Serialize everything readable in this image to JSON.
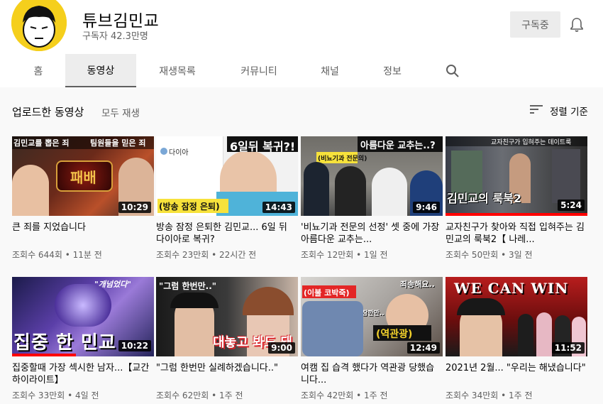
{
  "channel": {
    "name": "튜브김민교",
    "subscribers": "구독자 42.3만명",
    "subscribe_label": "구독중"
  },
  "tabs": [
    {
      "label": "홈"
    },
    {
      "label": "동영상"
    },
    {
      "label": "재생목록"
    },
    {
      "label": "커뮤니티"
    },
    {
      "label": "채널"
    },
    {
      "label": "정보"
    }
  ],
  "section": {
    "title": "업로드한 동영상",
    "play_all": "모두 재생",
    "sort_label": "정렬 기준"
  },
  "videos": [
    {
      "title": "큰 죄를 지었습니다",
      "views": "조회수 644회",
      "time": "11분 전",
      "duration": "10:29",
      "thumb_text": [
        "김민교를 뽑은 죄",
        "팀원들을 믿은 죄",
        "패배"
      ],
      "watched": 0
    },
    {
      "title": "방송 잠정 은퇴한 김민교... 6일 뒤 다이아로 복귀?",
      "views": "조회수 23만회",
      "time": "22시간 전",
      "duration": "14:43",
      "thumb_text": [
        "6일뒤 복귀?!",
        "다이아",
        "(방송 잠정 은퇴)"
      ],
      "watched": 0
    },
    {
      "title": "'비뇨기과 전문의 선정' 셋 중에 가장 아름다운 교추는...",
      "views": "조회수 12만회",
      "time": "1일 전",
      "duration": "9:46",
      "thumb_text": [
        "아름다운 교추는..?",
        "(비뇨기과 전문의)"
      ],
      "watched": 0
    },
    {
      "title": "교자친구가 찾아와 직접 입혀주는 김민교의 룩북2【 나레...",
      "views": "조회수 50만회",
      "time": "3일 전",
      "duration": "5:24",
      "thumb_text": [
        "교자친구가 입혀주는 데이트룩",
        "김민교의 룩북2"
      ],
      "watched": 1.0
    },
    {
      "title": "집중할때 가장 섹시한 남자...【교간 하이라이트】",
      "views": "조회수 33만회",
      "time": "4일 전",
      "duration": "10:22",
      "thumb_text": [
        "\"개넘었다\"",
        "집중 한 민교"
      ],
      "watched": 0.45
    },
    {
      "title": "\"그럼 한번만 실례하겠습니다..\"",
      "views": "조회수 62만회",
      "time": "1주 전",
      "duration": "9:00",
      "thumb_text": [
        "\"그럼 한번만..\"",
        "대놓고 봐도 돼"
      ],
      "watched": 0
    },
    {
      "title": "여캠 집 습격 했다가 역관광 당했습니다...",
      "views": "조회수 42만회",
      "time": "1주 전",
      "duration": "12:49",
      "thumb_text": [
        "(이불 코박죽)",
        "죄송해요..",
        "(역관광)",
        "잠깐만.."
      ],
      "watched": 0
    },
    {
      "title": "2021년 2월... \"우리는 해냈습니다\"",
      "views": "조회수 34만회",
      "time": "1주 전",
      "duration": "11:52",
      "thumb_text": [
        "WE CAN WIN"
      ],
      "watched": 0
    }
  ]
}
